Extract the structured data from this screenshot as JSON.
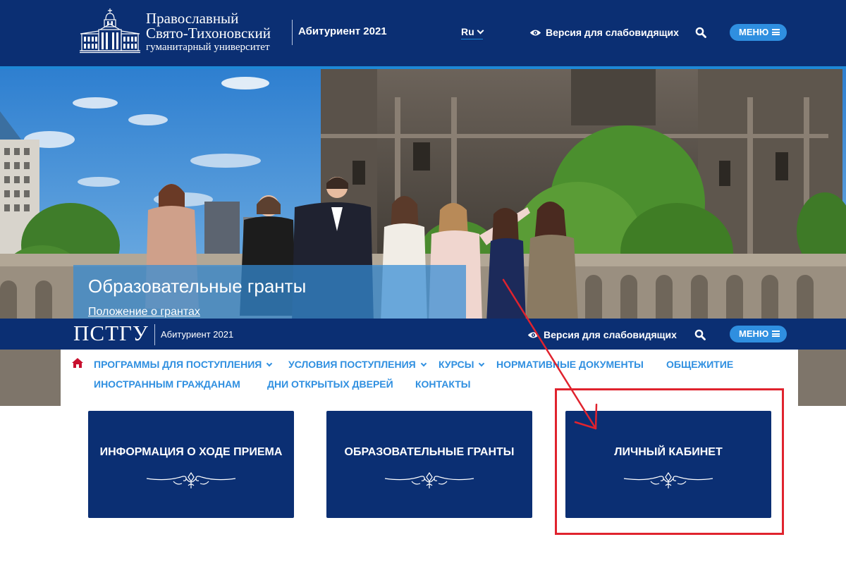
{
  "header": {
    "logo": {
      "line1": "Православный",
      "line2": "Свято-Тихоновский",
      "line3": "гуманитарный университет"
    },
    "section_label": "Абитуриент 2021",
    "language": "Ru",
    "accessibility_label": "Версия для слабовидящих",
    "menu_label": "МЕНЮ"
  },
  "hero": {
    "title": "Образовательные гранты",
    "link": "Положение о грантах"
  },
  "sticky_bar": {
    "logo_text": "ПСТГУ",
    "section_label": "Абитуриент 2021",
    "accessibility_label": "Версия для слабовидящих",
    "menu_label": "МЕНЮ"
  },
  "nav": {
    "items": [
      {
        "label": "ПРОГРАММЫ ДЛЯ ПОСТУПЛЕНИЯ",
        "dropdown": true
      },
      {
        "label": "УСЛОВИЯ ПОСТУПЛЕНИЯ",
        "dropdown": true
      },
      {
        "label": "КУРСЫ",
        "dropdown": true
      },
      {
        "label": "НОРМАТИВНЫЕ ДОКУМЕНТЫ",
        "dropdown": false
      },
      {
        "label": "ОБЩЕЖИТИЕ",
        "dropdown": false
      },
      {
        "label": "ИНОСТРАННЫМ ГРАЖДАНАМ",
        "dropdown": false
      },
      {
        "label": "ДНИ ОТКРЫТЫХ ДВЕРЕЙ",
        "dropdown": false
      },
      {
        "label": "КОНТАКТЫ",
        "dropdown": false
      }
    ]
  },
  "cards": [
    {
      "title": "ИНФОРМАЦИЯ О ХОДЕ ПРИЕМА"
    },
    {
      "title": "ОБРАЗОВАТЕЛЬНЫЕ ГРАНТЫ"
    },
    {
      "title": "ЛИЧНЫЙ КАБИНЕТ"
    }
  ],
  "colors": {
    "header_blue": "#0b2f73",
    "accent_blue": "#2f8fe0",
    "annotation_red": "#e0232e"
  },
  "icons": [
    "university-building-icon",
    "eye-icon",
    "search-icon",
    "hamburger-icon",
    "home-icon",
    "chevron-down-icon",
    "ornament-icon",
    "annotation-arrow"
  ]
}
